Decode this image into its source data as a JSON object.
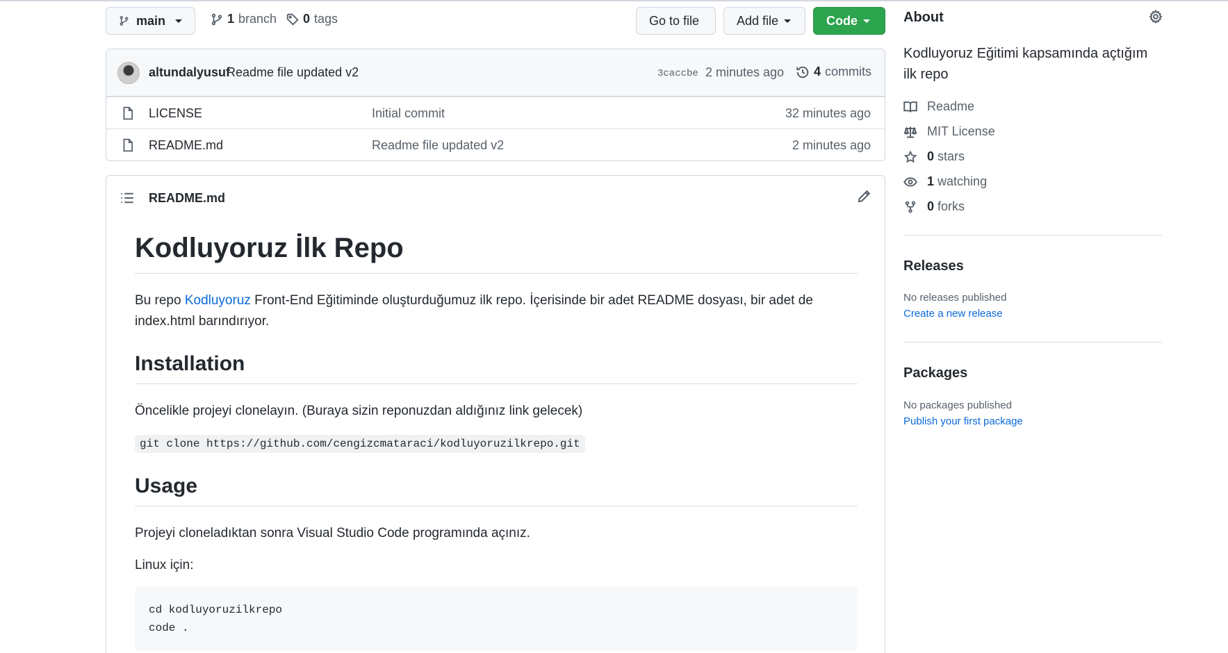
{
  "toolbar": {
    "branch_button": "main",
    "branch_count": "1",
    "branch_label": "branch",
    "tags_count": "0",
    "tags_label": "tags",
    "go_to_file": "Go to file",
    "add_file": "Add file",
    "code": "Code"
  },
  "commit": {
    "author": "altundalyusuf",
    "message": "Readme file updated v2",
    "sha": "3caccbe",
    "time": "2 minutes ago",
    "count": "4",
    "count_label": "commits"
  },
  "files": [
    {
      "name": "LICENSE",
      "message": "Initial commit",
      "time": "32 minutes ago"
    },
    {
      "name": "README.md",
      "message": "Readme file updated v2",
      "time": "2 minutes ago"
    }
  ],
  "readme": {
    "filename": "README.md",
    "h1": "Kodluyoruz İlk Repo",
    "intro_before": "Bu repo ",
    "intro_link": "Kodluyoruz",
    "intro_after": " Front-End Eğitiminde oluşturduğumuz ilk repo. İçerisinde bir adet README dosyası, bir adet de index.html barındırıyor.",
    "h2_install": "Installation",
    "install_text": "Öncelikle projeyi clonelayın. (Buraya sizin reponuzdan aldığınız link gelecek)",
    "install_code": "git clone https://github.com/cengizcmataraci/kodluyoruzilkrepo.git",
    "h2_usage": "Usage",
    "usage_text": "Projeyi cloneladıktan sonra Visual Studio Code programında açınız.",
    "linux_text": "Linux için:",
    "code_line1": "cd kodluyoruzilkrepo",
    "code_line2": "code ."
  },
  "about": {
    "title": "About",
    "description": "Kodluyoruz Eğitimi kapsamında açtığım ilk repo",
    "readme": "Readme",
    "license": "MIT License",
    "stars_count": "0",
    "stars_label": "stars",
    "watching_count": "1",
    "watching_label": "watching",
    "forks_count": "0",
    "forks_label": "forks"
  },
  "releases": {
    "title": "Releases",
    "note": "No releases published",
    "link": "Create a new release"
  },
  "packages": {
    "title": "Packages",
    "note": "No packages published",
    "link": "Publish your first package"
  },
  "colors": {
    "accent_green": "#2da44e",
    "link_blue": "#0969da",
    "border": "#d0d7de",
    "muted_text": "#57606a"
  }
}
